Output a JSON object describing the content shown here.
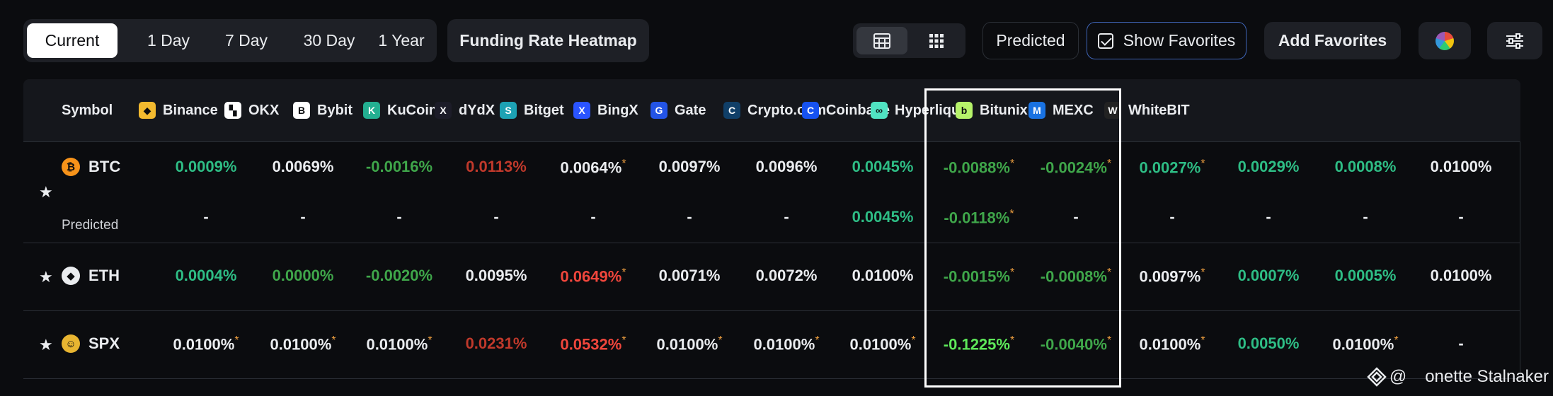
{
  "toolbar": {
    "periods": [
      {
        "label": "Current",
        "active": true
      },
      {
        "label": "1 Day",
        "active": false
      },
      {
        "label": "7 Day",
        "active": false
      },
      {
        "label": "30 Day",
        "active": false
      },
      {
        "label": "1 Year",
        "active": false
      }
    ],
    "heatmap_label": "Funding Rate Heatmap",
    "predicted_label": "Predicted",
    "show_favorites_label": "Show Favorites",
    "add_favorites_label": "Add Favorites"
  },
  "table": {
    "symbol_header": "Symbol",
    "exchanges": [
      {
        "name": "Binance",
        "logo_color": "#f3ba2f",
        "logo_text": "◆"
      },
      {
        "name": "OKX",
        "logo_color": "#ffffff",
        "logo_text": "▚"
      },
      {
        "name": "Bybit",
        "logo_color": "#ffffff",
        "logo_text": "B"
      },
      {
        "name": "KuCoin",
        "logo_color": "#23af91",
        "logo_text": "K"
      },
      {
        "name": "dYdX",
        "logo_color": "#1c1c28",
        "logo_text": "X"
      },
      {
        "name": "Bitget",
        "logo_color": "#1da2b4",
        "logo_text": "S"
      },
      {
        "name": "BingX",
        "logo_color": "#2a54ff",
        "logo_text": "X"
      },
      {
        "name": "Gate",
        "logo_color": "#2354e6",
        "logo_text": "G"
      },
      {
        "name": "Crypto.com",
        "logo_color": "#103f68",
        "logo_text": "C"
      },
      {
        "name": "Coinbase",
        "logo_color": "#1652f0",
        "logo_text": "C"
      },
      {
        "name": "Hyperliquid",
        "logo_color": "#50e3c2",
        "logo_text": "∞"
      },
      {
        "name": "Bitunix",
        "logo_color": "#b6f36a",
        "logo_text": "b"
      },
      {
        "name": "MEXC",
        "logo_color": "#1972e2",
        "logo_text": "M"
      },
      {
        "name": "WhiteBIT",
        "logo_color": "#222222",
        "logo_text": "W"
      }
    ],
    "predicted_row_label": "Predicted",
    "rows": [
      {
        "symbol": "BTC",
        "coin_color": "#f7931a",
        "coin_text": "₿",
        "values": [
          {
            "v": "0.0009%",
            "c": "#2ebd85",
            "a": false
          },
          {
            "v": "0.0069%",
            "c": "#eaecef",
            "a": false
          },
          {
            "v": "-0.0016%",
            "c": "#3fa64a",
            "a": false
          },
          {
            "v": "0.0113%",
            "c": "#c0392b",
            "a": false
          },
          {
            "v": "0.0064%",
            "c": "#eaecef",
            "a": true
          },
          {
            "v": "0.0097%",
            "c": "#eaecef",
            "a": false
          },
          {
            "v": "0.0096%",
            "c": "#eaecef",
            "a": false
          },
          {
            "v": "0.0045%",
            "c": "#2ebd85",
            "a": false
          },
          {
            "v": "-0.0088%",
            "c": "#3fa64a",
            "a": true
          },
          {
            "v": "-0.0024%",
            "c": "#3fa64a",
            "a": true
          },
          {
            "v": "0.0027%",
            "c": "#2ebd85",
            "a": true
          },
          {
            "v": "0.0029%",
            "c": "#2ebd85",
            "a": false
          },
          {
            "v": "0.0008%",
            "c": "#2ebd85",
            "a": false
          },
          {
            "v": "0.0100%",
            "c": "#eaecef",
            "a": false
          }
        ],
        "predicted": [
          {
            "v": "-",
            "c": "#eaecef",
            "a": false
          },
          {
            "v": "-",
            "c": "#eaecef",
            "a": false
          },
          {
            "v": "-",
            "c": "#eaecef",
            "a": false
          },
          {
            "v": "-",
            "c": "#eaecef",
            "a": false
          },
          {
            "v": "-",
            "c": "#eaecef",
            "a": false
          },
          {
            "v": "-",
            "c": "#eaecef",
            "a": false
          },
          {
            "v": "-",
            "c": "#eaecef",
            "a": false
          },
          {
            "v": "0.0045%",
            "c": "#2ebd85",
            "a": false
          },
          {
            "v": "-0.0118%",
            "c": "#3fa64a",
            "a": true
          },
          {
            "v": "-",
            "c": "#eaecef",
            "a": false
          },
          {
            "v": "-",
            "c": "#eaecef",
            "a": false
          },
          {
            "v": "-",
            "c": "#eaecef",
            "a": false
          },
          {
            "v": "-",
            "c": "#eaecef",
            "a": false
          },
          {
            "v": "-",
            "c": "#eaecef",
            "a": false
          }
        ]
      },
      {
        "symbol": "ETH",
        "coin_color": "#eaecef",
        "coin_text": "◆",
        "values": [
          {
            "v": "0.0004%",
            "c": "#2ebd85",
            "a": false
          },
          {
            "v": "0.0000%",
            "c": "#3fa64a",
            "a": false
          },
          {
            "v": "-0.0020%",
            "c": "#3fa64a",
            "a": false
          },
          {
            "v": "0.0095%",
            "c": "#eaecef",
            "a": false
          },
          {
            "v": "0.0649%",
            "c": "#f0463c",
            "a": true
          },
          {
            "v": "0.0071%",
            "c": "#eaecef",
            "a": false
          },
          {
            "v": "0.0072%",
            "c": "#eaecef",
            "a": false
          },
          {
            "v": "0.0100%",
            "c": "#eaecef",
            "a": false
          },
          {
            "v": "-0.0015%",
            "c": "#3fa64a",
            "a": true
          },
          {
            "v": "-0.0008%",
            "c": "#3fa64a",
            "a": true
          },
          {
            "v": "0.0097%",
            "c": "#eaecef",
            "a": true
          },
          {
            "v": "0.0007%",
            "c": "#2ebd85",
            "a": false
          },
          {
            "v": "0.0005%",
            "c": "#2ebd85",
            "a": false
          },
          {
            "v": "0.0100%",
            "c": "#eaecef",
            "a": false
          }
        ]
      },
      {
        "symbol": "SPX",
        "coin_color": "#e8b531",
        "coin_text": "☺",
        "values": [
          {
            "v": "0.0100%",
            "c": "#eaecef",
            "a": true
          },
          {
            "v": "0.0100%",
            "c": "#eaecef",
            "a": true
          },
          {
            "v": "0.0100%",
            "c": "#eaecef",
            "a": true
          },
          {
            "v": "0.0231%",
            "c": "#c0392b",
            "a": false
          },
          {
            "v": "0.0532%",
            "c": "#f0463c",
            "a": true
          },
          {
            "v": "0.0100%",
            "c": "#eaecef",
            "a": true
          },
          {
            "v": "0.0100%",
            "c": "#eaecef",
            "a": true
          },
          {
            "v": "0.0100%",
            "c": "#eaecef",
            "a": true
          },
          {
            "v": "-0.1225%",
            "c": "#5ee85a",
            "a": true
          },
          {
            "v": "-0.0040%",
            "c": "#3fa64a",
            "a": true
          },
          {
            "v": "0.0100%",
            "c": "#eaecef",
            "a": true
          },
          {
            "v": "0.0050%",
            "c": "#2ebd85",
            "a": false
          },
          {
            "v": "0.0100%",
            "c": "#eaecef",
            "a": true
          },
          {
            "v": "-",
            "c": "#eaecef",
            "a": false
          }
        ]
      }
    ]
  },
  "watermark": {
    "prefix": "@",
    "text": "onette Stalnaker"
  }
}
